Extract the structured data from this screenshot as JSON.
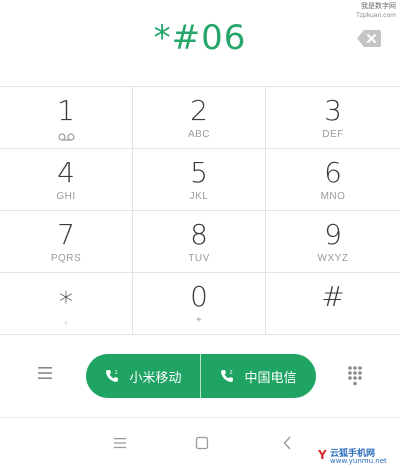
{
  "watermark_top": {
    "line1": "我是数字网",
    "line2": "Tzpkuan.com"
  },
  "display": {
    "number": "*#06",
    "backspace_icon": "backspace-icon"
  },
  "keys": [
    {
      "digit": "1",
      "letters": "",
      "icon": "voicemail-icon"
    },
    {
      "digit": "2",
      "letters": "ABC"
    },
    {
      "digit": "3",
      "letters": "DEF"
    },
    {
      "digit": "4",
      "letters": "GHI"
    },
    {
      "digit": "5",
      "letters": "JKL"
    },
    {
      "digit": "6",
      "letters": "MNO"
    },
    {
      "digit": "7",
      "letters": "PQRS"
    },
    {
      "digit": "8",
      "letters": "TUV"
    },
    {
      "digit": "9",
      "letters": "WXYZ"
    },
    {
      "digit": "∗",
      "letters": ","
    },
    {
      "digit": "0",
      "letters": "+"
    },
    {
      "digit": "#",
      "letters": ""
    }
  ],
  "bottom_bar": {
    "menu_icon": "menu-icon",
    "sim1_label": "小米移动",
    "sim2_label": "中国电信",
    "dialpad_icon": "dialpad-grid-icon"
  },
  "nav": {
    "icons": [
      "recents-menu-icon",
      "home-square-icon",
      "back-chevron-icon"
    ]
  },
  "watermark_bottom": {
    "line1": "云狐手机网",
    "line2": "www.yunmu.net"
  },
  "colors": {
    "accent": "#26a66b",
    "call_button": "#1fa463",
    "divider": "#e3e3e3",
    "digit": "#3a3a3a",
    "letters": "#9a9a9a"
  }
}
